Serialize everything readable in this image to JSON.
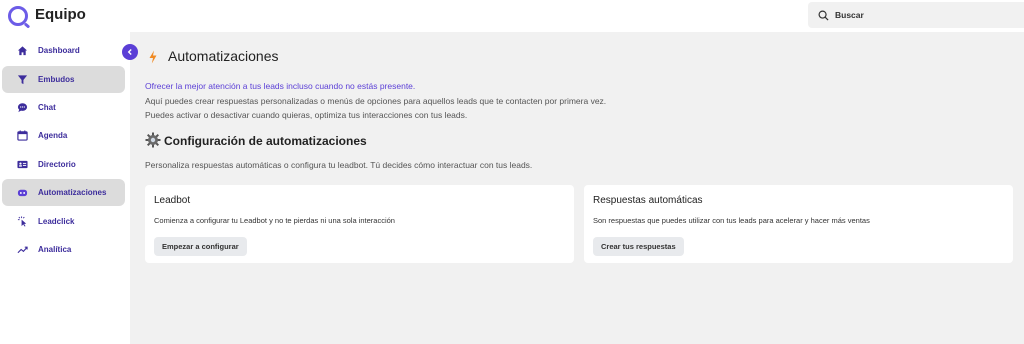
{
  "header": {
    "brand": "Equipo",
    "search_label": "Buscar"
  },
  "sidebar": {
    "items": [
      {
        "label": "Dashboard",
        "icon": "home-icon",
        "active": false
      },
      {
        "label": "Embudos",
        "icon": "funnel-icon",
        "active": true
      },
      {
        "label": "Chat",
        "icon": "chat-icon",
        "active": false
      },
      {
        "label": "Agenda",
        "icon": "calendar-icon",
        "active": false
      },
      {
        "label": "Directorio",
        "icon": "contact-card-icon",
        "active": false
      },
      {
        "label": "Automatizaciones",
        "icon": "robot-icon",
        "active": true
      },
      {
        "label": "Leadclick",
        "icon": "click-icon",
        "active": false
      },
      {
        "label": "Analítica",
        "icon": "trend-icon",
        "active": false
      }
    ]
  },
  "main": {
    "title": "Automatizaciones",
    "lead_link": "Ofrecer la mejor atención a tus leads incluso cuando no estás presente.",
    "desc1": "Aquí puedes crear respuestas personalizadas o menús de opciones para aquellos leads que te contacten por primera vez.",
    "desc2": "Puedes activar o desactivar cuando quieras, optimiza tus interacciones con tus leads.",
    "section_title": "Configuración de automatizaciones",
    "section_sub": "Personaliza respuestas automáticas o configura tu leadbot. Tú decides cómo interactuar con tus leads.",
    "cards": [
      {
        "title": "Leadbot",
        "description": "Comienza a configurar tu Leadbot y no te pierdas ni una sola interacción",
        "button": "Empezar a configurar"
      },
      {
        "title": "Respuestas automáticas",
        "description": "Son respuestas que puedes utilizar con tus leads para acelerar y hacer más ventas",
        "button": "Crear tus respuestas"
      }
    ]
  },
  "colors": {
    "accent": "#5b3fd6",
    "nav_text": "#3d2d9c",
    "active_bg": "#dcdcdc",
    "bolt": "#f08a24"
  }
}
